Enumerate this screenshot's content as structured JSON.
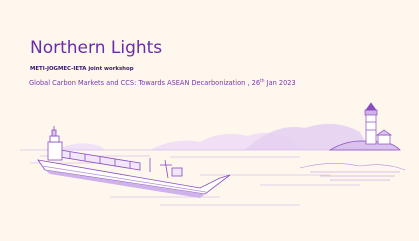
{
  "slide": {
    "title": "Northern Lights",
    "subtitle": "METI-JOGMEC-IETA joint workshop",
    "headline_text": "Global Carbon Markets and CCS: Towards ASEAN Decarbonization , 26",
    "headline_date_suffix": "th",
    "headline_tail": " Jan 2023",
    "colors": {
      "background": "#fdf7ee",
      "title": "#6a2ca6",
      "subtitle": "#3a1470",
      "headline": "#7a35b4",
      "artwork_line": "#8a4cc0",
      "artwork_fill": "#d9c2ee"
    }
  }
}
